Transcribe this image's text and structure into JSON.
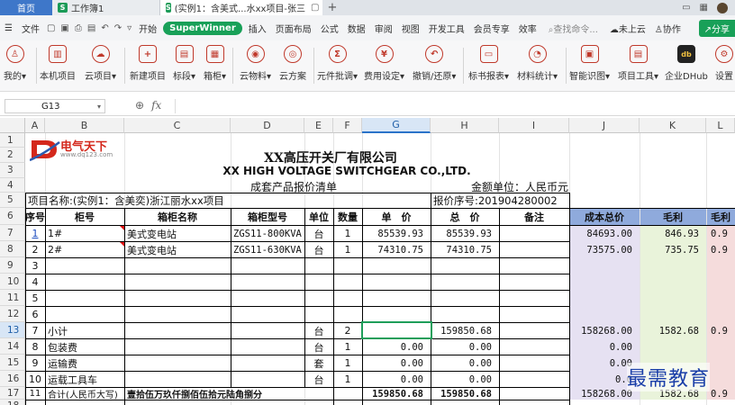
{
  "tabs": {
    "home": "首页",
    "workbook": "工作簿1",
    "document": "(实例1：含美式...水xx项目-张三"
  },
  "menu": {
    "file": "文件",
    "items": [
      "开始",
      "插入",
      "页面布局",
      "公式",
      "数据",
      "审阅",
      "视图",
      "开发工具",
      "会员专享",
      "效率"
    ],
    "superwinner": "SuperWinner",
    "search": "查找命令...",
    "cloud": "未上云",
    "collab": "协作",
    "share": "分享"
  },
  "ribbon": [
    {
      "label": "我的▾",
      "icon": "user-icon"
    },
    {
      "label": "本机项目",
      "icon": "folder-icon"
    },
    {
      "label": "云项目▾",
      "icon": "cloud-icon"
    },
    {
      "label": "新建项目",
      "icon": "plus-icon"
    },
    {
      "label": "标段▾",
      "icon": "section-icon"
    },
    {
      "label": "箱柜▾",
      "icon": "cabinet-icon"
    },
    {
      "label": "云物料▾",
      "icon": "material-icon"
    },
    {
      "label": "云方案",
      "icon": "plan-icon"
    },
    {
      "label": "元件批调▾",
      "icon": "component-icon"
    },
    {
      "label": "费用设定▾",
      "icon": "fee-icon"
    },
    {
      "label": "撤销/还原▾",
      "icon": "undo-icon"
    },
    {
      "label": "标书报表▾",
      "icon": "report-icon"
    },
    {
      "label": "材料统计▾",
      "icon": "stats-icon"
    },
    {
      "label": "智能识图▾",
      "icon": "recognize-icon"
    },
    {
      "label": "项目工具▾",
      "icon": "tools-icon"
    },
    {
      "label": "企业DHub",
      "icon": "dhub-icon"
    },
    {
      "label": "设置",
      "icon": "settings-icon"
    }
  ],
  "formula_bar": {
    "cell_ref": "G13",
    "fx": "fx"
  },
  "columns": [
    "A",
    "B",
    "C",
    "D",
    "E",
    "F",
    "G",
    "H",
    "I",
    "J",
    "K",
    "L"
  ],
  "rows": [
    "1",
    "2",
    "3",
    "4",
    "5",
    "6",
    "7",
    "8",
    "9",
    "10",
    "11",
    "12",
    "13",
    "14",
    "15",
    "16",
    "17",
    "18"
  ],
  "sheet": {
    "logo_text": "电气天下",
    "logo_url": "www.dq123.com",
    "company_cn": "XX高压开关厂有限公司",
    "company_en": "XX HIGH VOLTAGE SWITCHGEAR CO.,LTD.",
    "subtitle": "成套产品报价清单",
    "currency": "金额单位：人民币元",
    "project": "项目名称:(实例1：含美奕)浙江丽水xx项目",
    "quote_no": "报价序号:201904280002",
    "headers": [
      "序号",
      "柜号",
      "箱柜名称",
      "箱柜型号",
      "单位",
      "数量",
      "单　价",
      "总　价",
      "备注",
      "成本总价",
      "毛利",
      "毛利"
    ],
    "lines": [
      {
        "no": "1",
        "cab": "1#",
        "name": "美式变电站",
        "model": "ZGS11-800KVA",
        "unit": "台",
        "qty": "1",
        "price": "85539.93",
        "total": "85539.93",
        "note": "",
        "cost": "84693.00",
        "gp": "846.93",
        "gpr": "0.9"
      },
      {
        "no": "2",
        "cab": "2#",
        "name": "美式变电站",
        "model": "ZGS11-630KVA",
        "unit": "台",
        "qty": "1",
        "price": "74310.75",
        "total": "74310.75",
        "note": "",
        "cost": "73575.00",
        "gp": "735.75",
        "gpr": "0.9"
      },
      {
        "no": "3"
      },
      {
        "no": "4"
      },
      {
        "no": "5"
      },
      {
        "no": "6"
      },
      {
        "no": "7",
        "cab": "小计",
        "unit": "台",
        "qty": "2",
        "total": "159850.68",
        "cost": "158268.00",
        "gp": "1582.68",
        "gpr": "0.9"
      },
      {
        "no": "8",
        "cab": "包装费",
        "unit": "台",
        "qty": "1",
        "price": "0.00",
        "total": "0.00",
        "cost": "0.00"
      },
      {
        "no": "9",
        "cab": "运输费",
        "unit": "套",
        "qty": "1",
        "price": "0.00",
        "total": "0.00",
        "cost": "0.00"
      },
      {
        "no": "10",
        "cab": "运载工具车",
        "unit": "台",
        "qty": "1",
        "price": "0.00",
        "total": "0.00",
        "cost": "0.0"
      },
      {
        "no": "11",
        "cab": "合计(人民币大写)",
        "name": "壹拾伍万玖仟捌佰伍拾元陆角捌分",
        "price": "159850.68",
        "total": "159850.68",
        "cost": "158268.00",
        "gp": "1582.68",
        "gpr": "0.9"
      }
    ]
  },
  "watermark": "最需教育"
}
